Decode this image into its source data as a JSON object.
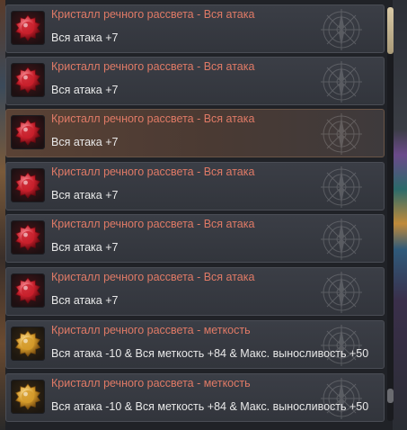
{
  "items": [
    {
      "name": "Кристалл речного рассвета - Вся атака",
      "desc": "Вся атака +7",
      "icon": "red-crystal-icon",
      "selected": false
    },
    {
      "name": "Кристалл речного рассвета - Вся атака",
      "desc": "Вся атака +7",
      "icon": "red-crystal-icon",
      "selected": false
    },
    {
      "name": "Кристалл речного рассвета - Вся атака",
      "desc": "Вся атака +7",
      "icon": "red-crystal-icon",
      "selected": true
    },
    {
      "name": "Кристалл речного рассвета - Вся атака",
      "desc": "Вся атака +7",
      "icon": "red-crystal-icon",
      "selected": false
    },
    {
      "name": "Кристалл речного рассвета - Вся атака",
      "desc": "Вся атака +7",
      "icon": "red-crystal-icon",
      "selected": false
    },
    {
      "name": "Кристалл речного рассвета - Вся атака",
      "desc": "Вся атака +7",
      "icon": "red-crystal-icon",
      "selected": false
    },
    {
      "name": "Кристалл речного рассвета - меткость",
      "desc": "Вся атака -10 & Вся меткость +84 & Макс. выносливость +50",
      "icon": "gold-crystal-icon",
      "selected": false
    },
    {
      "name": "Кристалл речного рассвета - меткость",
      "desc": "Вся атака -10 & Вся меткость +84 & Макс. выносливость +50",
      "icon": "gold-crystal-icon",
      "selected": false
    }
  ],
  "colors": {
    "item_name": "#e07a66",
    "item_desc": "#e9e9e9",
    "red_crystal": "#c8202c",
    "gold_crystal": "#d49a2a",
    "scroll_thumb": "#d8c9a6"
  }
}
